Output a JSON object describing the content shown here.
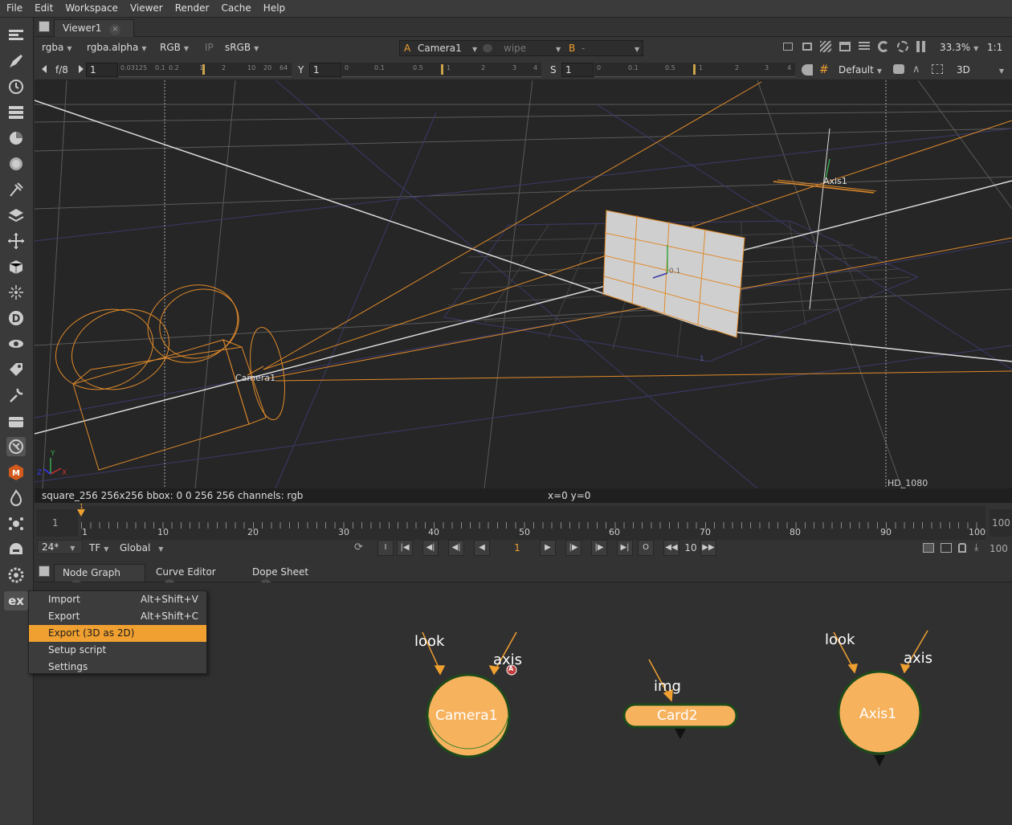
{
  "menubar": [
    "File",
    "Edit",
    "Workspace",
    "Viewer",
    "Render",
    "Cache",
    "Help"
  ],
  "viewer_tab": {
    "label": "Viewer1",
    "close": "×"
  },
  "viewer_controls": {
    "channels": "rgba",
    "alpha": "rgba.alpha",
    "display": "RGB",
    "ip": "IP",
    "colorspace": "sRGB",
    "input_a_label": "A",
    "input_a": "Camera1",
    "wipe": "wipe",
    "input_b_label": "B",
    "input_b": "-",
    "zoom": "33.3%",
    "ratio": "1:1",
    "fstop": "f/8",
    "gain_value": "1",
    "gain_ticks": [
      "0.03125",
      "0.1",
      "0.2",
      "1",
      "2",
      "10",
      "20",
      "64"
    ],
    "gamma_label": "Y",
    "gamma_value": "1",
    "gamma_ticks": [
      "0",
      "0.1",
      "0.5",
      "1",
      "2",
      "3",
      "4"
    ],
    "sat_label": "S",
    "sat_value": "1",
    "sat_ticks": [
      "0",
      "0.1",
      "0.5",
      "1",
      "2",
      "3",
      "4"
    ],
    "lut": "Default",
    "view_mode": "3D"
  },
  "viewport": {
    "camera_label": "Camera1",
    "axis_label": "Axis1",
    "format_label": "HD_1080",
    "card_label": "0.1",
    "axis_y": "Y",
    "axis_z": "Z",
    "axis_x": "X",
    "grid_mark": "1"
  },
  "status": {
    "info": "square_256 256x256  bbox: 0 0 256 256 channels: rgb",
    "coords": "x=0 y=0"
  },
  "timeline": {
    "start_frame": "1",
    "end_frame": "100",
    "end_frame_right": "100",
    "ticks": [
      "1",
      "10",
      "20",
      "30",
      "40",
      "50",
      "60",
      "70",
      "80",
      "90",
      "100"
    ],
    "playhead_label": "1",
    "fps": "24*",
    "tf": "TF",
    "range": "Global",
    "current_frame": "1",
    "increment": "10",
    "transport": {
      "in": "I",
      "out": "O"
    }
  },
  "panel_tabs": [
    {
      "label": "Node Graph",
      "close": "×"
    },
    {
      "label": "Curve Editor",
      "close": "×"
    },
    {
      "label": "Dope Sheet",
      "close": "×"
    }
  ],
  "toolbar_ex": "ex",
  "context_menu": [
    {
      "label": "Import",
      "shortcut": "Alt+Shift+V"
    },
    {
      "label": "Export",
      "shortcut": "Alt+Shift+C"
    },
    {
      "label": "Export (3D as 2D)",
      "shortcut": ""
    },
    {
      "label": "Setup script",
      "shortcut": ""
    },
    {
      "label": "Settings",
      "shortcut": ""
    }
  ],
  "nodes": {
    "camera": {
      "name": "Camera1",
      "input1": "look",
      "input2": "axis",
      "badge": "A"
    },
    "card": {
      "name": "Card2",
      "input1": "img"
    },
    "axis": {
      "name": "Axis1",
      "input1": "look",
      "input2": "axis"
    }
  },
  "colors": {
    "accent": "#f0a030",
    "node_fill": "#f7b25e",
    "node_border": "#1d4a1a",
    "wireframe": "#e08a2a"
  }
}
